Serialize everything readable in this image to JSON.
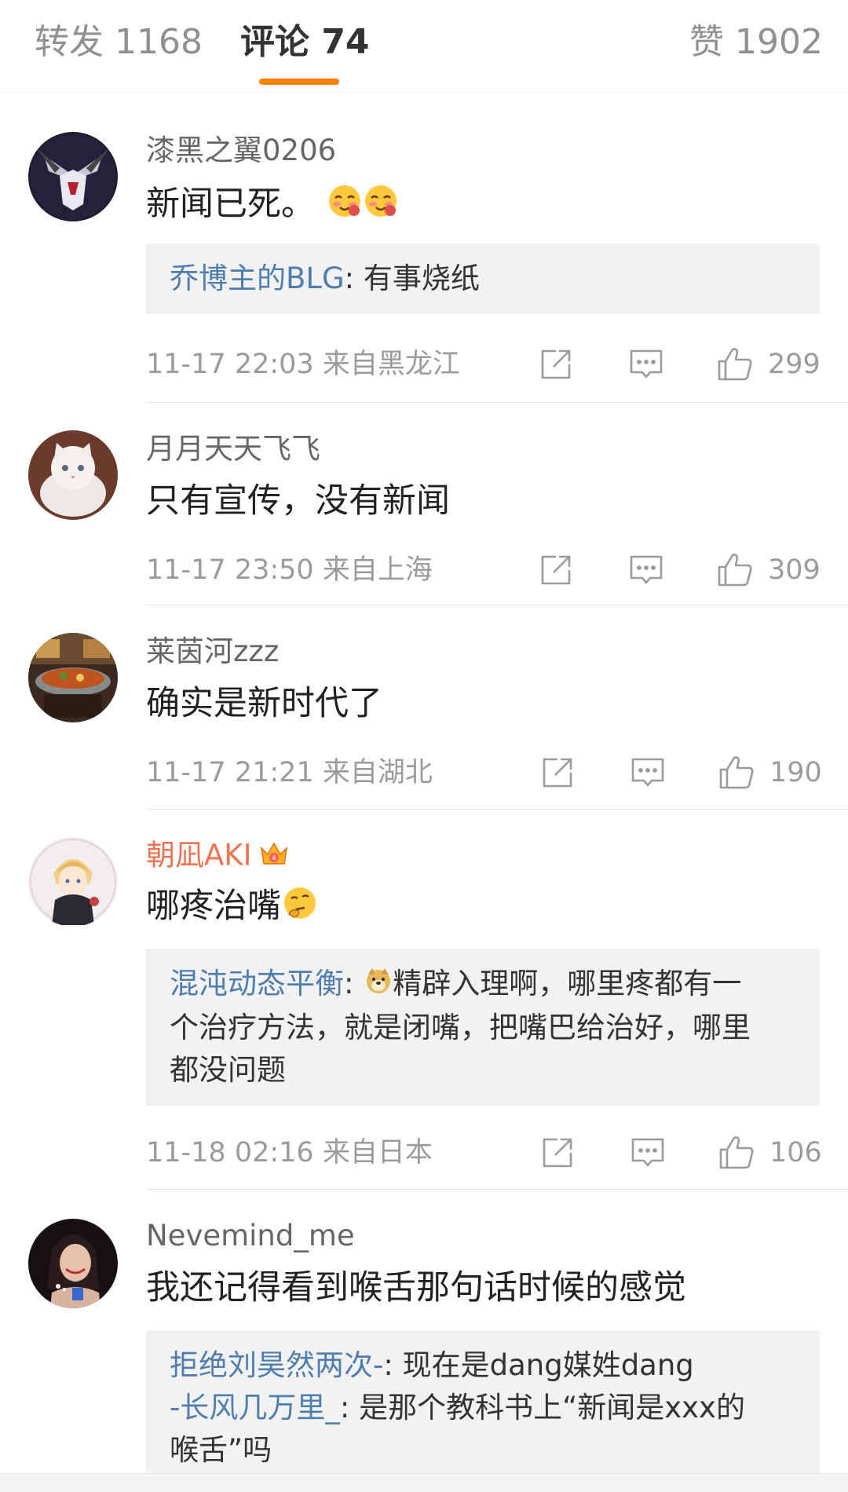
{
  "tabs": {
    "repost": "转发 1168",
    "comments": "评论 74",
    "likes": "赞 1902"
  },
  "colors": {
    "accent": "#ff8200",
    "link": "#507daf",
    "vip_name": "#eb7350",
    "meta": "#9b9b9b"
  },
  "icons": {
    "share": "share-icon",
    "comment": "comment-icon",
    "like": "thumbs-up-icon"
  },
  "comments": [
    {
      "name": "漆黑之翼0206",
      "text": "新闻已死。",
      "emoji": [
        "blush-emoji",
        "blush-emoji"
      ],
      "replies": [
        {
          "user": "乔博主的BLG",
          "sep": ": ",
          "lines": [
            "有事烧纸"
          ]
        }
      ],
      "time": "11-17 22:03",
      "location": "来自黑龙江",
      "likes": "299"
    },
    {
      "name": "月月天天飞飞",
      "text": "只有宣传，没有新闻",
      "time": "11-17 23:50",
      "location": "来自上海",
      "likes": "309"
    },
    {
      "name": "莱茵河zzz",
      "text": "确实是新时代了",
      "time": "11-17 21:21",
      "location": "来自湖北",
      "likes": "190"
    },
    {
      "name": "朝凪AKI",
      "badge": "crown-icon",
      "text": "哪疼治嘴",
      "emoji": [
        "thinking-emoji"
      ],
      "replies": [
        {
          "user": "混沌动态平衡",
          "sep": ": ",
          "lines": [
            "精辟入理啊，哪里疼都有一",
            "个治疗方法，就是闭嘴，把嘴巴给治好，哪里",
            "都没问题"
          ]
        }
      ],
      "time": "11-18 02:16",
      "location": "来自日本",
      "likes": "106"
    },
    {
      "name": "Nevemind_me",
      "text": "我还记得看到喉舌那句话时候的感觉",
      "replies": [
        {
          "user": "拒绝刘昊然两次-",
          "sep": ": ",
          "lines": [
            "现在是dang媒姓dang"
          ]
        },
        {
          "user": "-长风几万里_",
          "sep": ": ",
          "lines": [
            "是那个教科书上“新闻是xxx的",
            "喉舌”吗"
          ]
        }
      ]
    }
  ]
}
